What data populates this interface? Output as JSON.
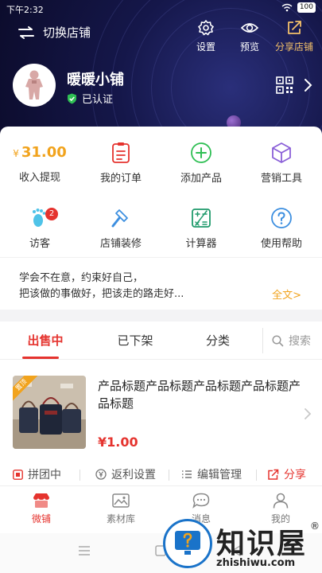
{
  "status_bar": {
    "time": "下午2:32",
    "battery": "100"
  },
  "header": {
    "switch_store": "切换店铺",
    "settings": "设置",
    "preview": "预览",
    "share_store": "分享店铺",
    "store_name": "暖暖小铺",
    "verified": "已认证"
  },
  "stats": {
    "currency": "¥",
    "balance": "31.00",
    "withdraw": "收入提现"
  },
  "grid": [
    {
      "label": "我的订单",
      "icon": "order-list-icon"
    },
    {
      "label": "添加产品",
      "icon": "plus-circle-icon"
    },
    {
      "label": "营销工具",
      "icon": "cube-icon"
    },
    {
      "label": "访客",
      "icon": "footprint-icon",
      "badge": "2"
    },
    {
      "label": "店铺装修",
      "icon": "hammer-icon"
    },
    {
      "label": "计算器",
      "icon": "calculator-icon"
    },
    {
      "label": "使用帮助",
      "icon": "help-icon"
    }
  ],
  "quote": {
    "line1": "学会不在意，约束好自己，",
    "line2": "把该做的事做好，把该走的路走好...",
    "full_text": "全文>"
  },
  "tabs": {
    "on_sale": "出售中",
    "off_shelf": "已下架",
    "category": "分类",
    "search": "搜索"
  },
  "product": {
    "ribbon": "置顶",
    "title": "产品标题产品标题产品标题产品标题产品标题",
    "price": "¥1.00",
    "actions": {
      "group_buy": "拼团中",
      "rebate": "返利设置",
      "edit": "编辑管理",
      "share": "分享"
    }
  },
  "nav": {
    "micro_store": "微铺",
    "materials": "素材库",
    "messages": "消息",
    "mine": "我的"
  },
  "watermark": {
    "name": "知识屋",
    "reg": "®",
    "url": "zhishiwu.com"
  },
  "colors": {
    "accent_red": "#e5332e",
    "accent_gold": "#f1a31d",
    "header_bg": "#15174a"
  }
}
